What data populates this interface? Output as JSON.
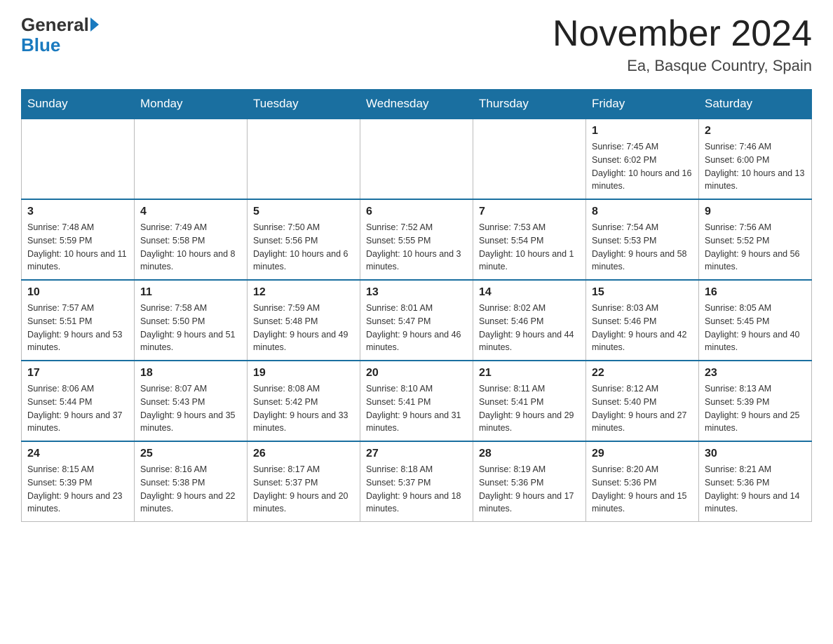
{
  "header": {
    "logo": {
      "general": "General",
      "blue": "Blue",
      "arrow": "▶"
    },
    "title": "November 2024",
    "location": "Ea, Basque Country, Spain"
  },
  "days_of_week": [
    "Sunday",
    "Monday",
    "Tuesday",
    "Wednesday",
    "Thursday",
    "Friday",
    "Saturday"
  ],
  "weeks": [
    {
      "days": [
        {
          "num": "",
          "info": ""
        },
        {
          "num": "",
          "info": ""
        },
        {
          "num": "",
          "info": ""
        },
        {
          "num": "",
          "info": ""
        },
        {
          "num": "",
          "info": ""
        },
        {
          "num": "1",
          "info": "Sunrise: 7:45 AM\nSunset: 6:02 PM\nDaylight: 10 hours and 16 minutes."
        },
        {
          "num": "2",
          "info": "Sunrise: 7:46 AM\nSunset: 6:00 PM\nDaylight: 10 hours and 13 minutes."
        }
      ]
    },
    {
      "days": [
        {
          "num": "3",
          "info": "Sunrise: 7:48 AM\nSunset: 5:59 PM\nDaylight: 10 hours and 11 minutes."
        },
        {
          "num": "4",
          "info": "Sunrise: 7:49 AM\nSunset: 5:58 PM\nDaylight: 10 hours and 8 minutes."
        },
        {
          "num": "5",
          "info": "Sunrise: 7:50 AM\nSunset: 5:56 PM\nDaylight: 10 hours and 6 minutes."
        },
        {
          "num": "6",
          "info": "Sunrise: 7:52 AM\nSunset: 5:55 PM\nDaylight: 10 hours and 3 minutes."
        },
        {
          "num": "7",
          "info": "Sunrise: 7:53 AM\nSunset: 5:54 PM\nDaylight: 10 hours and 1 minute."
        },
        {
          "num": "8",
          "info": "Sunrise: 7:54 AM\nSunset: 5:53 PM\nDaylight: 9 hours and 58 minutes."
        },
        {
          "num": "9",
          "info": "Sunrise: 7:56 AM\nSunset: 5:52 PM\nDaylight: 9 hours and 56 minutes."
        }
      ]
    },
    {
      "days": [
        {
          "num": "10",
          "info": "Sunrise: 7:57 AM\nSunset: 5:51 PM\nDaylight: 9 hours and 53 minutes."
        },
        {
          "num": "11",
          "info": "Sunrise: 7:58 AM\nSunset: 5:50 PM\nDaylight: 9 hours and 51 minutes."
        },
        {
          "num": "12",
          "info": "Sunrise: 7:59 AM\nSunset: 5:48 PM\nDaylight: 9 hours and 49 minutes."
        },
        {
          "num": "13",
          "info": "Sunrise: 8:01 AM\nSunset: 5:47 PM\nDaylight: 9 hours and 46 minutes."
        },
        {
          "num": "14",
          "info": "Sunrise: 8:02 AM\nSunset: 5:46 PM\nDaylight: 9 hours and 44 minutes."
        },
        {
          "num": "15",
          "info": "Sunrise: 8:03 AM\nSunset: 5:46 PM\nDaylight: 9 hours and 42 minutes."
        },
        {
          "num": "16",
          "info": "Sunrise: 8:05 AM\nSunset: 5:45 PM\nDaylight: 9 hours and 40 minutes."
        }
      ]
    },
    {
      "days": [
        {
          "num": "17",
          "info": "Sunrise: 8:06 AM\nSunset: 5:44 PM\nDaylight: 9 hours and 37 minutes."
        },
        {
          "num": "18",
          "info": "Sunrise: 8:07 AM\nSunset: 5:43 PM\nDaylight: 9 hours and 35 minutes."
        },
        {
          "num": "19",
          "info": "Sunrise: 8:08 AM\nSunset: 5:42 PM\nDaylight: 9 hours and 33 minutes."
        },
        {
          "num": "20",
          "info": "Sunrise: 8:10 AM\nSunset: 5:41 PM\nDaylight: 9 hours and 31 minutes."
        },
        {
          "num": "21",
          "info": "Sunrise: 8:11 AM\nSunset: 5:41 PM\nDaylight: 9 hours and 29 minutes."
        },
        {
          "num": "22",
          "info": "Sunrise: 8:12 AM\nSunset: 5:40 PM\nDaylight: 9 hours and 27 minutes."
        },
        {
          "num": "23",
          "info": "Sunrise: 8:13 AM\nSunset: 5:39 PM\nDaylight: 9 hours and 25 minutes."
        }
      ]
    },
    {
      "days": [
        {
          "num": "24",
          "info": "Sunrise: 8:15 AM\nSunset: 5:39 PM\nDaylight: 9 hours and 23 minutes."
        },
        {
          "num": "25",
          "info": "Sunrise: 8:16 AM\nSunset: 5:38 PM\nDaylight: 9 hours and 22 minutes."
        },
        {
          "num": "26",
          "info": "Sunrise: 8:17 AM\nSunset: 5:37 PM\nDaylight: 9 hours and 20 minutes."
        },
        {
          "num": "27",
          "info": "Sunrise: 8:18 AM\nSunset: 5:37 PM\nDaylight: 9 hours and 18 minutes."
        },
        {
          "num": "28",
          "info": "Sunrise: 8:19 AM\nSunset: 5:36 PM\nDaylight: 9 hours and 17 minutes."
        },
        {
          "num": "29",
          "info": "Sunrise: 8:20 AM\nSunset: 5:36 PM\nDaylight: 9 hours and 15 minutes."
        },
        {
          "num": "30",
          "info": "Sunrise: 8:21 AM\nSunset: 5:36 PM\nDaylight: 9 hours and 14 minutes."
        }
      ]
    }
  ]
}
